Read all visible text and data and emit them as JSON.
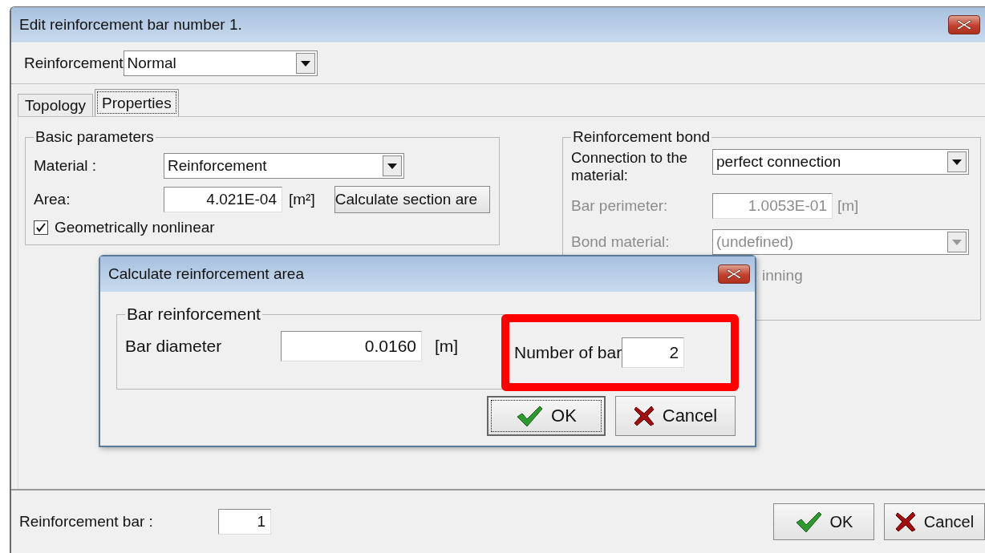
{
  "window": {
    "title": "Edit reinforcement bar number 1."
  },
  "reinforcement": {
    "label": "Reinforcement",
    "value": "Normal"
  },
  "tabs": [
    {
      "label": "Topology",
      "selected": false
    },
    {
      "label": "Properties",
      "selected": true
    }
  ],
  "basic_parameters": {
    "title": "Basic parameters",
    "material": {
      "label": "Material :",
      "value": "Reinforcement"
    },
    "area": {
      "label": "Area:",
      "value": "4.021E-04",
      "unit": "[m²]"
    },
    "calculate_button": "Calculate section are",
    "geometrically_nonlinear": {
      "label": "Geometrically nonlinear",
      "checked": true
    }
  },
  "reinforcement_bond": {
    "title": "Reinforcement bond",
    "connection": {
      "label": "Connection to the material:",
      "value": "perfect connection",
      "disabled": false
    },
    "bar_perimeter": {
      "label": "Bar perimeter:",
      "value": "1.0053E-01",
      "unit": "[m]",
      "disabled": true
    },
    "bond_material": {
      "label": "Bond material:",
      "value": "(undefined)",
      "disabled": true
    },
    "option": {
      "label": "inning",
      "disabled": true
    }
  },
  "bottom": {
    "label": "Reinforcement bar :",
    "value": "1"
  },
  "buttons": [
    {
      "label": "OK",
      "kind": "ok",
      "focused": false
    },
    {
      "label": "Cancel",
      "kind": "cancel",
      "focused": false
    }
  ],
  "dialog": {
    "title": "Calculate reinforcement area",
    "group": "Bar reinforcement",
    "diameter": {
      "label": "Bar diameter",
      "value": "0.0160",
      "unit": "[m]"
    },
    "number_of_bars": {
      "label": "Number of bar",
      "value": "2",
      "highlighted": true
    },
    "buttons": [
      {
        "label": "OK",
        "kind": "ok",
        "focused": true
      },
      {
        "label": "Cancel",
        "kind": "cancel",
        "focused": false
      }
    ]
  }
}
